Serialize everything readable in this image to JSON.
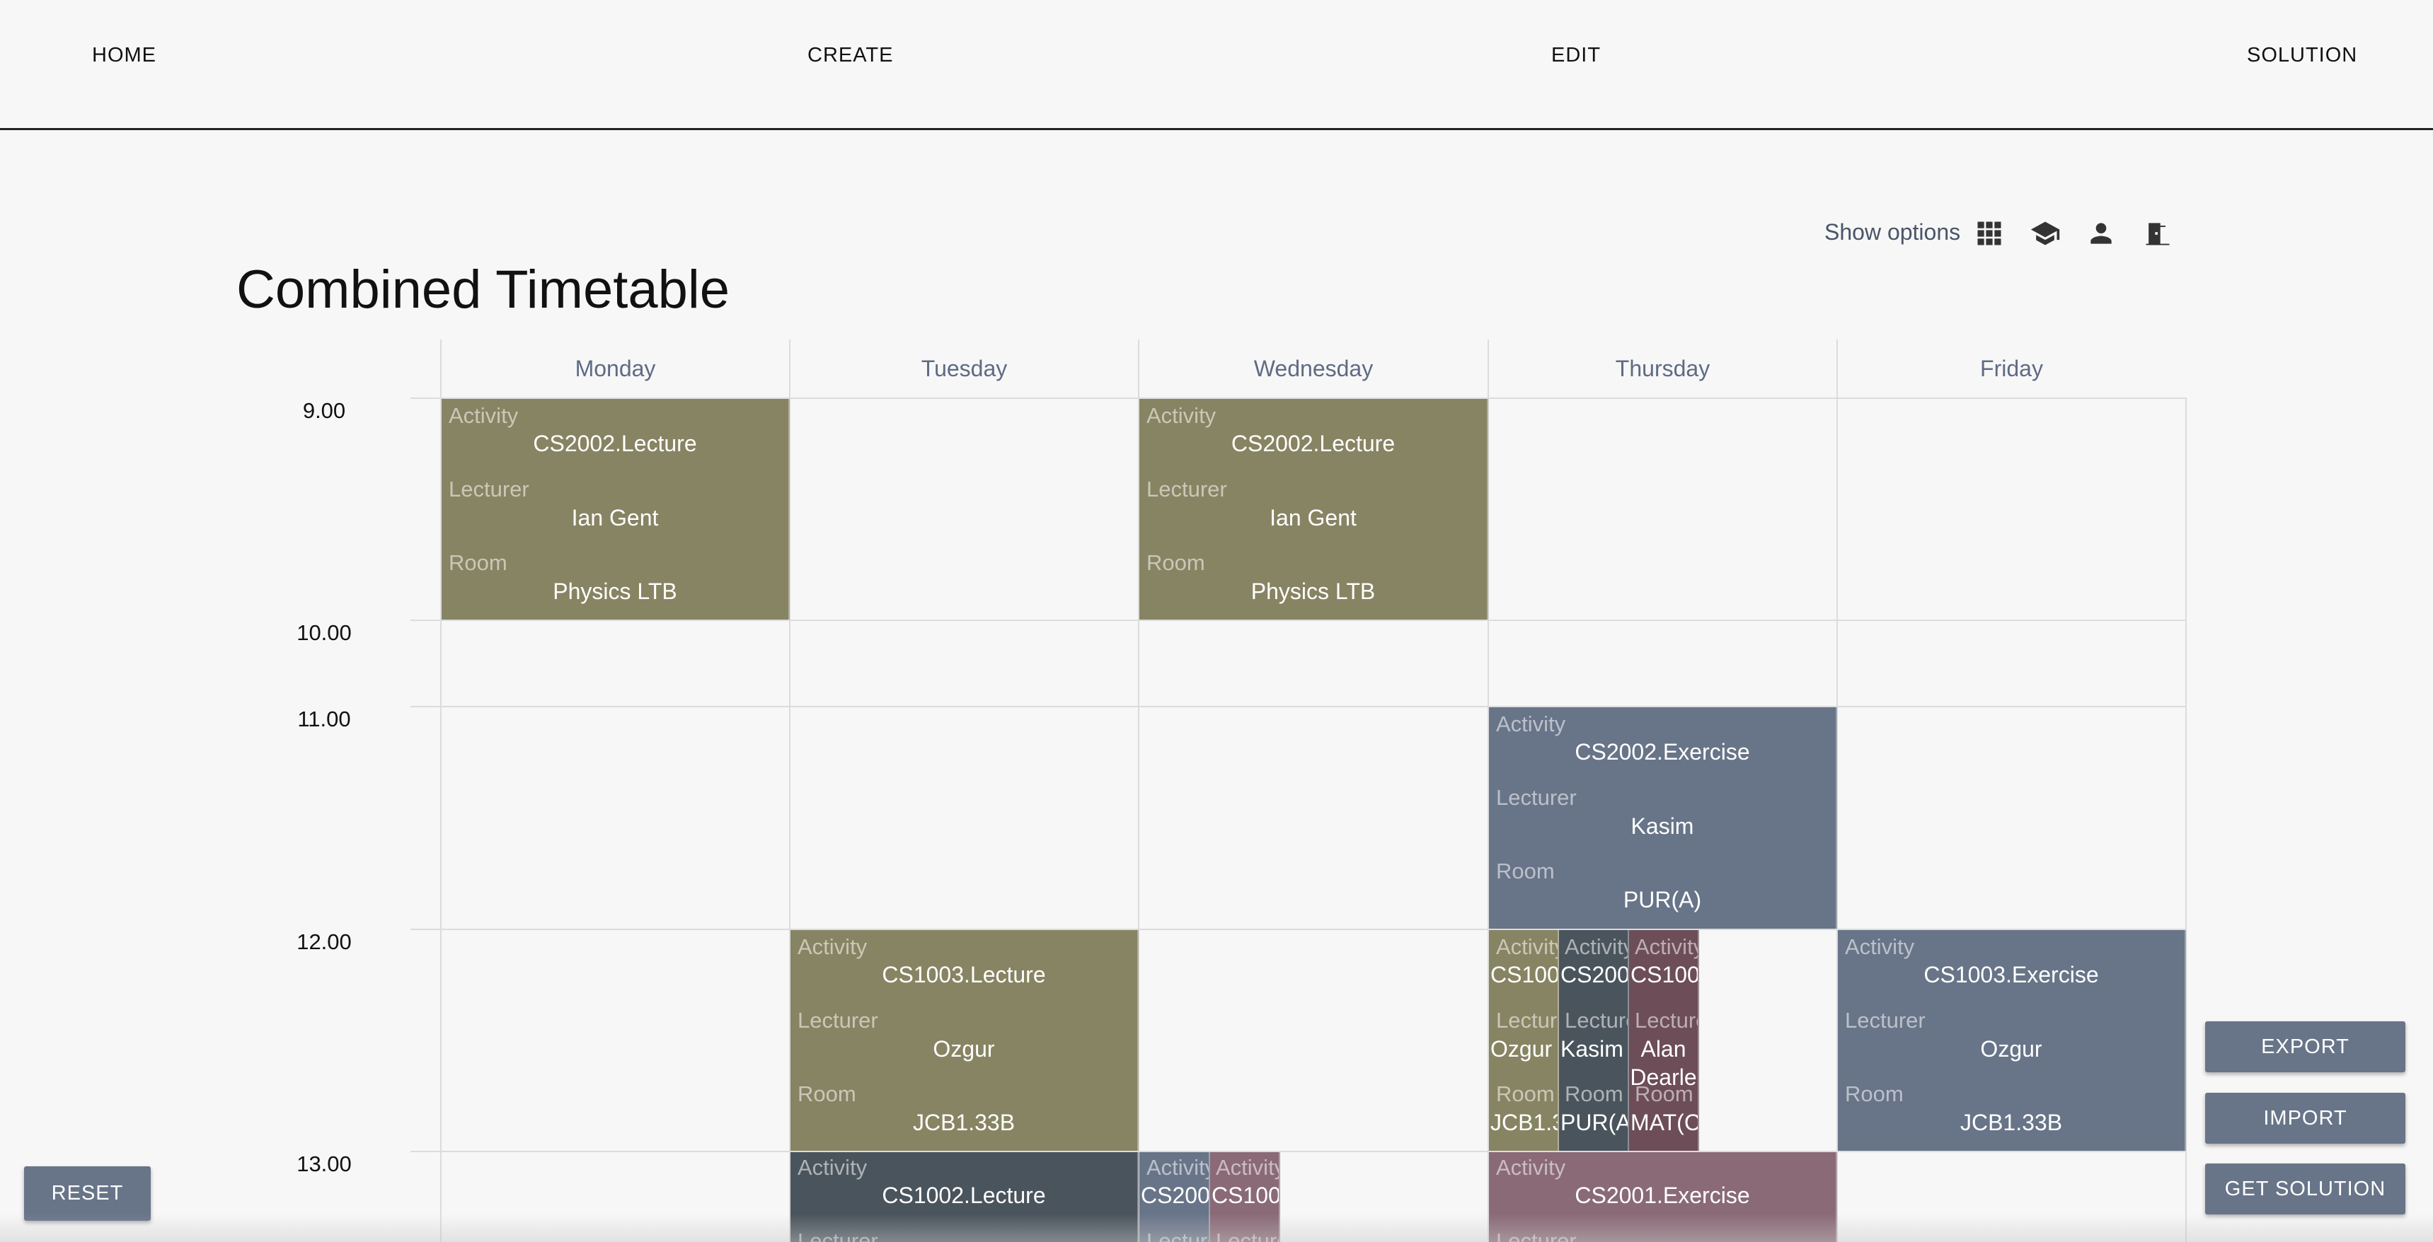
{
  "nav": {
    "home": "HOME",
    "create": "CREATE",
    "edit": "EDIT",
    "solution": "SOLUTION"
  },
  "page_title": "Combined Timetable",
  "show_options": {
    "label": "Show options",
    "icons": [
      "grid-icon",
      "graduation-cap-icon",
      "person-icon",
      "door-icon"
    ]
  },
  "days": [
    "Monday",
    "Tuesday",
    "Wednesday",
    "Thursday",
    "Friday"
  ],
  "times": [
    "9.00",
    "10.00",
    "11.00",
    "12.00",
    "13.00"
  ],
  "field_labels": {
    "activity": "Activity",
    "lecturer": "Lecturer",
    "room": "Room"
  },
  "events": [
    {
      "day": "Monday",
      "start": "9.00",
      "activity": "CS2002.Lecture",
      "lecturer": "Ian Gent",
      "room": "Physics LTB",
      "color": "#878463"
    },
    {
      "day": "Wednesday",
      "start": "9.00",
      "activity": "CS2002.Lecture",
      "lecturer": "Ian Gent",
      "room": "Physics LTB",
      "color": "#878463"
    },
    {
      "day": "Thursday",
      "start": "11.00",
      "activity": "CS2002.Exercise",
      "lecturer": "Kasim",
      "room": "PUR(A)",
      "color": "#687488"
    },
    {
      "day": "Tuesday",
      "start": "12.00",
      "activity": "CS1003.Lecture",
      "lecturer": "Ozgur",
      "room": "JCB1.33B",
      "color": "#878463"
    },
    {
      "day": "Thursday",
      "start": "12.00",
      "activity": "CS100",
      "lecturer": "Ozgur",
      "room": "JCB1.3",
      "color": "#878463"
    },
    {
      "day": "Thursday",
      "start": "12.00",
      "activity": "CS200",
      "lecturer": "Kasim",
      "room": "PUR(A",
      "color": "#4a545d"
    },
    {
      "day": "Thursday",
      "start": "12.00",
      "activity": "CS100",
      "lecturer": "Alan Dearle",
      "room": "MAT(C",
      "color": "#6c4d58"
    },
    {
      "day": "Friday",
      "start": "12.00",
      "activity": "CS1003.Exercise",
      "lecturer": "Ozgur",
      "room": "JCB1.33B",
      "color": "#687488"
    },
    {
      "day": "Tuesday",
      "start": "13.00",
      "activity": "CS1002.Lecture",
      "color": "#4a545d"
    },
    {
      "day": "Wednesday",
      "start": "13.00",
      "activity": "CS200",
      "color": "#687488"
    },
    {
      "day": "Wednesday",
      "start": "13.00",
      "activity": "CS100",
      "color": "#8a6a77"
    },
    {
      "day": "Thursday",
      "start": "13.00",
      "activity": "CS2001.Exercise",
      "color": "#8a6a77"
    }
  ],
  "buttons": {
    "export": "EXPORT",
    "import": "IMPORT",
    "get_solution": "GET SOLUTION",
    "reset": "RESET"
  }
}
